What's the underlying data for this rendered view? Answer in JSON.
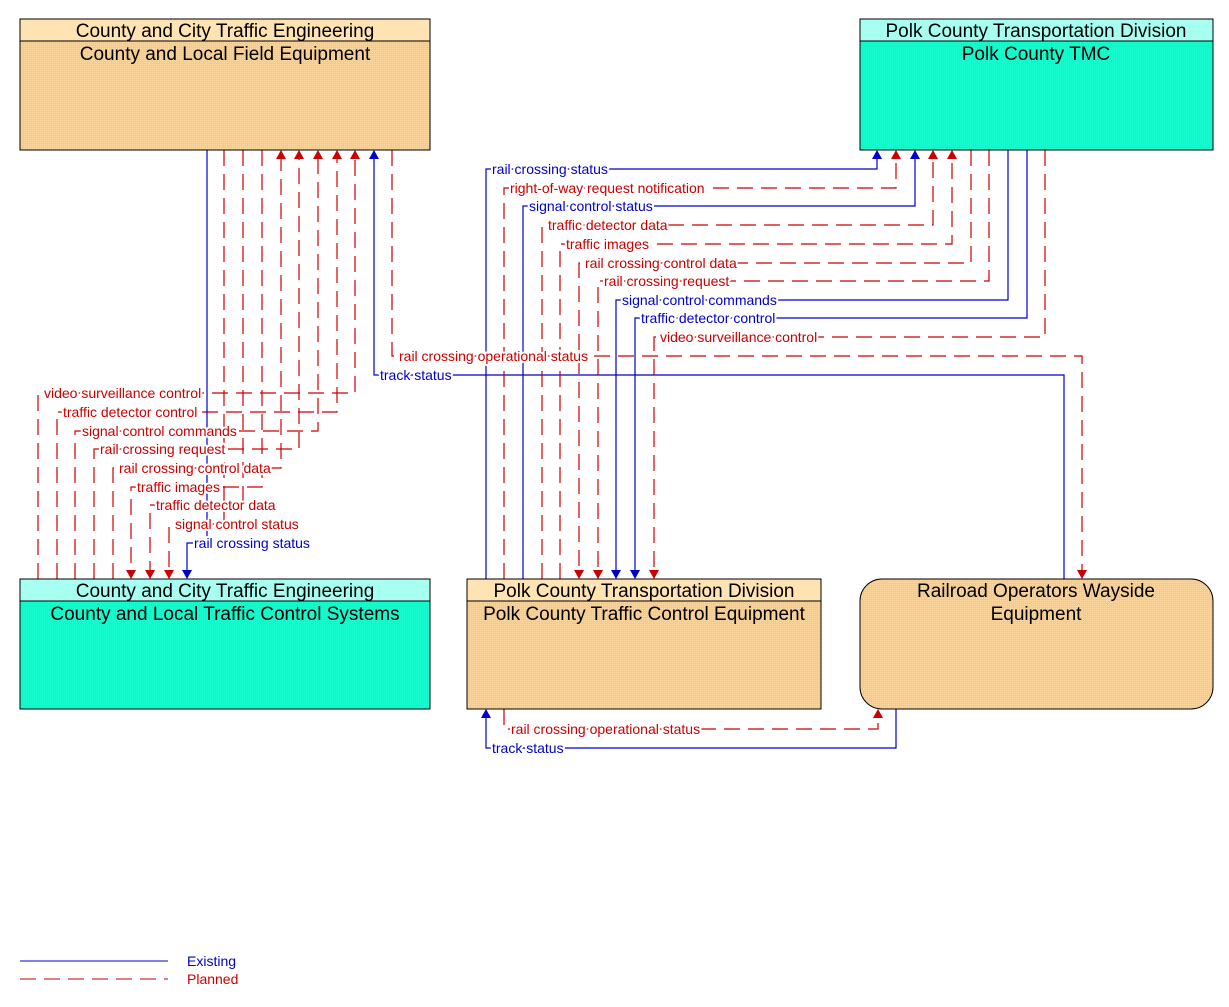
{
  "colors": {
    "existing": "#0000cc",
    "planned": "#cc0000",
    "orange_body": "#ffc882",
    "orange_header": "#ffe3b3",
    "cyan_body": "#00ffcc",
    "cyan_header": "#a6fff0"
  },
  "entities": {
    "field": {
      "header": "County and City Traffic Engineering",
      "name": "County and Local Field Equipment",
      "style": "orange"
    },
    "tmc": {
      "header": "Polk County Transportation Division",
      "name": "Polk County TMC",
      "style": "cyan"
    },
    "tcs": {
      "header": "County and City Traffic Engineering",
      "name": "County and Local Traffic Control Systems",
      "style": "cyan"
    },
    "ptce": {
      "header": "Polk County Transportation Division",
      "name": "Polk County Traffic Control Equipment",
      "style": "orange"
    },
    "rail": {
      "header": "",
      "name_line1": "Railroad Operators Wayside",
      "name_line2": "Equipment",
      "style": "orange"
    }
  },
  "flows": [
    {
      "label": "video surveillance control",
      "from": "tcs",
      "to": "field",
      "status": "planned"
    },
    {
      "label": "traffic detector control",
      "from": "tcs",
      "to": "field",
      "status": "planned"
    },
    {
      "label": "signal control commands",
      "from": "tcs",
      "to": "field",
      "status": "planned"
    },
    {
      "label": "rail crossing request",
      "from": "tcs",
      "to": "field",
      "status": "planned"
    },
    {
      "label": "rail crossing control data",
      "from": "tcs",
      "to": "field",
      "status": "planned"
    },
    {
      "label": "traffic images",
      "from": "field",
      "to": "tcs",
      "status": "planned"
    },
    {
      "label": "traffic detector data",
      "from": "field",
      "to": "tcs",
      "status": "planned"
    },
    {
      "label": "signal control status",
      "from": "field",
      "to": "tcs",
      "status": "planned"
    },
    {
      "label": "rail crossing status",
      "from": "field",
      "to": "tcs",
      "status": "existing"
    },
    {
      "label": "rail crossing operational status",
      "from": "field",
      "to": "rail",
      "status": "planned"
    },
    {
      "label": "track status",
      "from": "rail",
      "to": "field",
      "status": "existing"
    },
    {
      "label": "rail crossing status",
      "from": "ptce",
      "to": "tmc",
      "status": "existing"
    },
    {
      "label": "right-of-way request notification",
      "from": "ptce",
      "to": "tmc",
      "status": "planned"
    },
    {
      "label": "signal control status",
      "from": "ptce",
      "to": "tmc",
      "status": "existing"
    },
    {
      "label": "traffic detector data",
      "from": "ptce",
      "to": "tmc",
      "status": "planned"
    },
    {
      "label": "traffic images",
      "from": "ptce",
      "to": "tmc",
      "status": "planned"
    },
    {
      "label": "rail crossing control data",
      "from": "tmc",
      "to": "ptce",
      "status": "planned"
    },
    {
      "label": "rail crossing request",
      "from": "tmc",
      "to": "ptce",
      "status": "planned"
    },
    {
      "label": "signal control commands",
      "from": "tmc",
      "to": "ptce",
      "status": "existing"
    },
    {
      "label": "traffic detector control",
      "from": "tmc",
      "to": "ptce",
      "status": "existing"
    },
    {
      "label": "video surveillance control",
      "from": "tmc",
      "to": "ptce",
      "status": "planned"
    },
    {
      "label": "rail crossing operational status",
      "from": "ptce",
      "to": "rail",
      "status": "planned"
    },
    {
      "label": "track status",
      "from": "rail",
      "to": "ptce",
      "status": "existing"
    }
  ],
  "legend": {
    "existing": "Existing",
    "planned": "Planned"
  }
}
